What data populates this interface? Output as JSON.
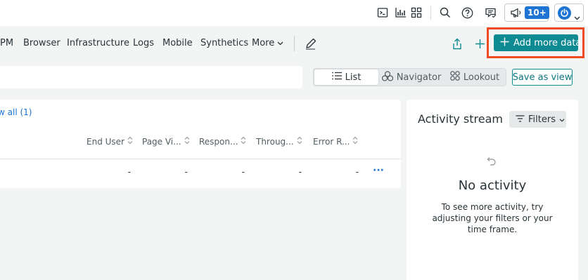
{
  "topbar": {
    "icons": [
      "terminal-icon",
      "dashboards-icon",
      "apps-grid-icon",
      "search-icon",
      "help-icon",
      "feedback-icon",
      "announcements-icon",
      "user-menu-icon"
    ],
    "badge": "10+"
  },
  "nav": {
    "items": [
      "PM",
      "Browser",
      "Infrastructure",
      "Logs",
      "Mobile",
      "Synthetics"
    ],
    "more_label": "More",
    "add_data_label": "Add more data"
  },
  "view_toggle": {
    "list_label": "List",
    "navigator_label": "Navigator",
    "lookout_label": "Lookout"
  },
  "save_view_label": "Save as view",
  "table": {
    "view_all_label": "w all (1)",
    "columns": [
      "End User",
      "Page Vi...",
      "Respon...",
      "Throug...",
      "Error R..."
    ],
    "rows": [
      {
        "cells": [
          "-",
          "-",
          "-",
          "-",
          "-"
        ],
        "actions": "···"
      }
    ]
  },
  "activity": {
    "title": "Activity stream",
    "filters_label": "Filters",
    "empty_title": "No activity",
    "empty_desc": "To see more activity, try adjusting your filters or your time frame."
  },
  "colors": {
    "accent": "#0e8a92",
    "highlight_outline": "#f04a23",
    "link": "#1d74d3",
    "badge": "#1d74d3"
  }
}
